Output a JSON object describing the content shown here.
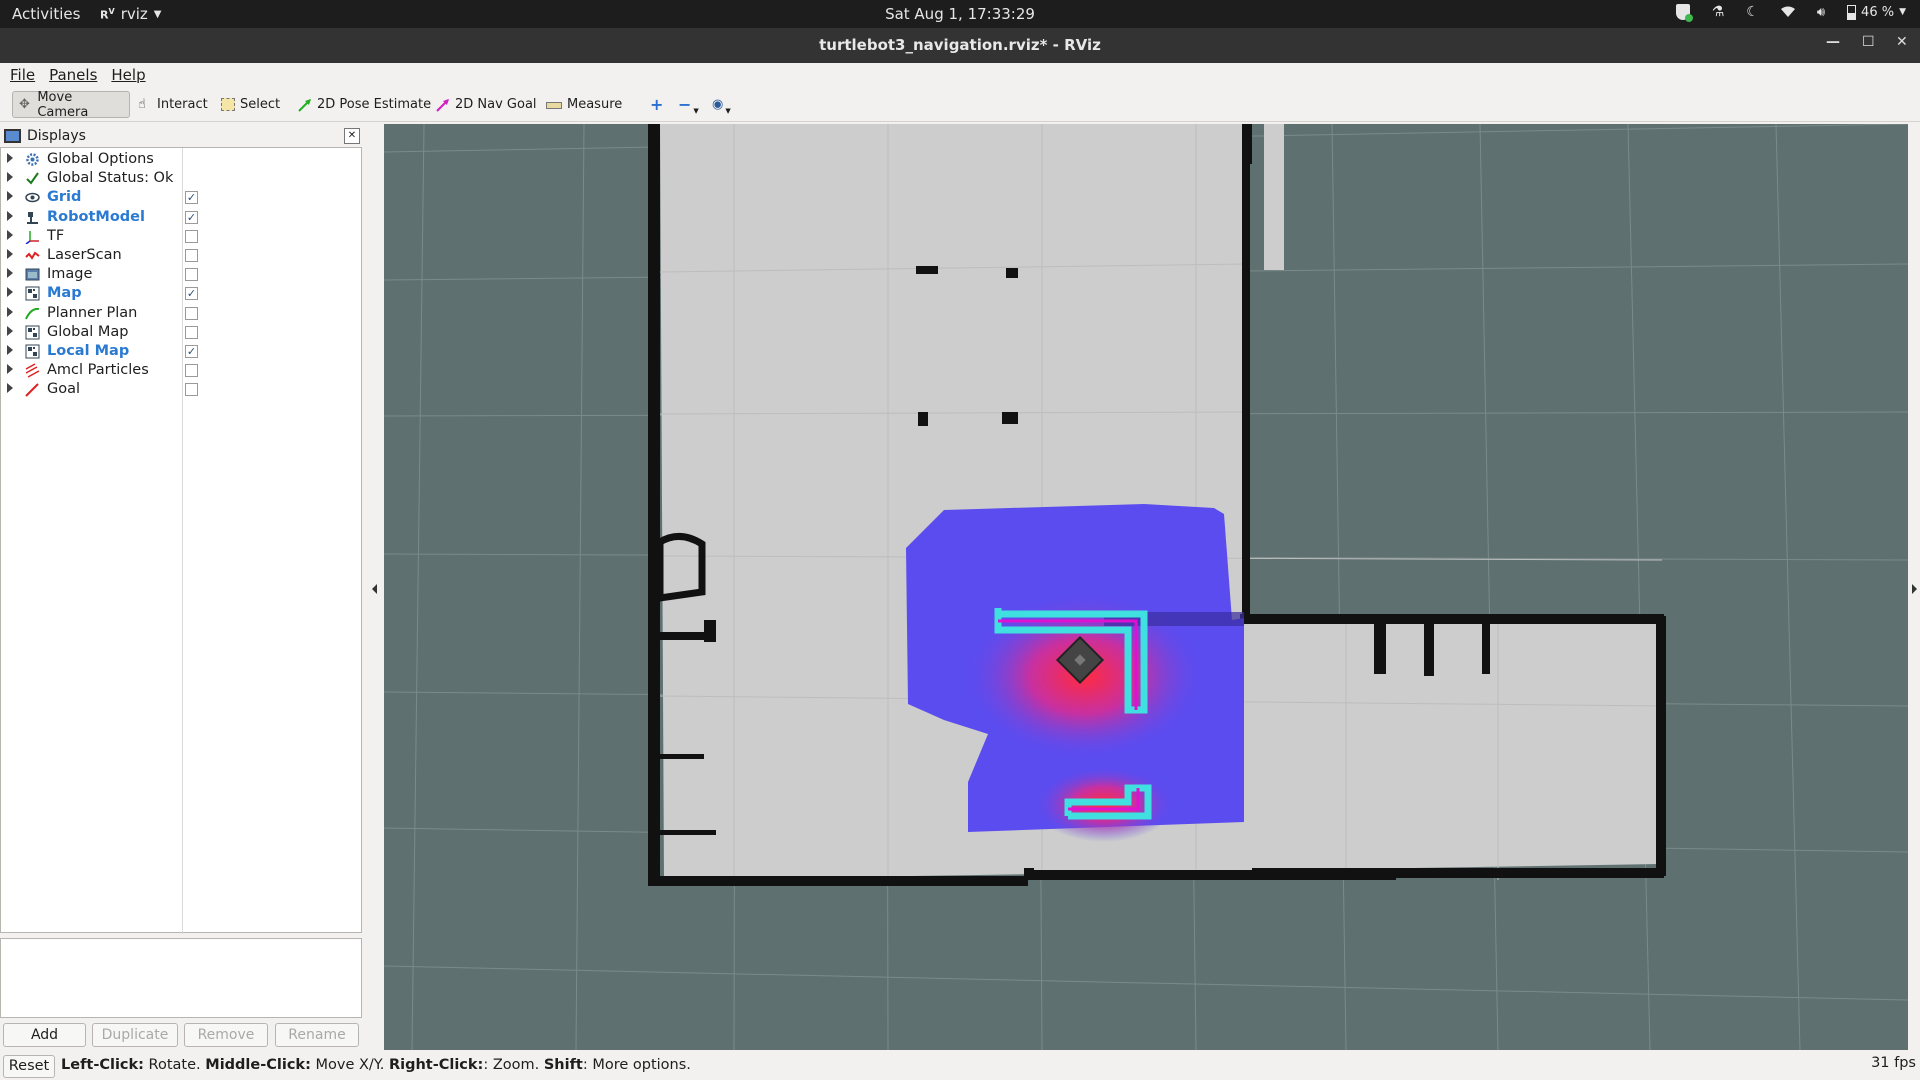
{
  "topbar": {
    "activities": "Activities",
    "app_name": "rviz",
    "clock": "Sat Aug  1, 17:33:29",
    "battery": "46 %"
  },
  "window": {
    "title": "turtlebot3_navigation.rviz* - RViz"
  },
  "menu": {
    "file": "File",
    "panels": "Panels",
    "help": "Help"
  },
  "toolbar": {
    "move_camera": "Move Camera",
    "interact": "Interact",
    "select": "Select",
    "pose_estimate": "2D Pose Estimate",
    "nav_goal": "2D Nav Goal",
    "measure": "Measure"
  },
  "displays": {
    "title": "Displays",
    "items": [
      {
        "label": "Global Options",
        "icon": "gear-icon",
        "check": null,
        "highlighted": false
      },
      {
        "label": "Global Status: Ok",
        "icon": "checkmark-icon",
        "check": null,
        "highlighted": false
      },
      {
        "label": "Grid",
        "icon": "grid-icon",
        "check": true,
        "highlighted": true
      },
      {
        "label": "RobotModel",
        "icon": "robot-icon",
        "check": true,
        "highlighted": true
      },
      {
        "label": "TF",
        "icon": "tf-axes-icon",
        "check": false,
        "highlighted": false
      },
      {
        "label": "LaserScan",
        "icon": "laserscan-icon",
        "check": false,
        "highlighted": false
      },
      {
        "label": "Image",
        "icon": "image-icon",
        "check": false,
        "highlighted": false
      },
      {
        "label": "Map",
        "icon": "map-icon",
        "check": true,
        "highlighted": true
      },
      {
        "label": "Planner Plan",
        "icon": "path-icon",
        "check": false,
        "highlighted": false
      },
      {
        "label": "Global Map",
        "icon": "map-icon",
        "check": false,
        "highlighted": false
      },
      {
        "label": "Local Map",
        "icon": "map-icon",
        "check": true,
        "highlighted": true
      },
      {
        "label": "Amcl Particles",
        "icon": "particles-icon",
        "check": false,
        "highlighted": false
      },
      {
        "label": "Goal",
        "icon": "goal-arrow-icon",
        "check": false,
        "highlighted": false
      }
    ],
    "buttons": {
      "add": "Add",
      "duplicate": "Duplicate",
      "remove": "Remove",
      "rename": "Rename"
    }
  },
  "status": {
    "reset": "Reset",
    "hint_left_key": "Left-Click:",
    "hint_left_val": " Rotate. ",
    "hint_mid_key": "Middle-Click:",
    "hint_mid_val": " Move X/Y. ",
    "hint_right_key": "Right-Click:",
    "hint_right_val": ": Zoom. ",
    "hint_shift_key": "Shift",
    "hint_shift_val": ": More options.",
    "fps": "31 fps"
  },
  "colors": {
    "accent_selected": "#2a7ad2",
    "viewport_bg": "#5f7071",
    "map_free": "#cdcdcd",
    "map_wall": "#111111",
    "costmap_blue": "#5b4cf0",
    "costmap_inflated": "#ff2a5a",
    "costmap_lethal": "#e010d0",
    "costmap_outline": "#40e0e0"
  }
}
